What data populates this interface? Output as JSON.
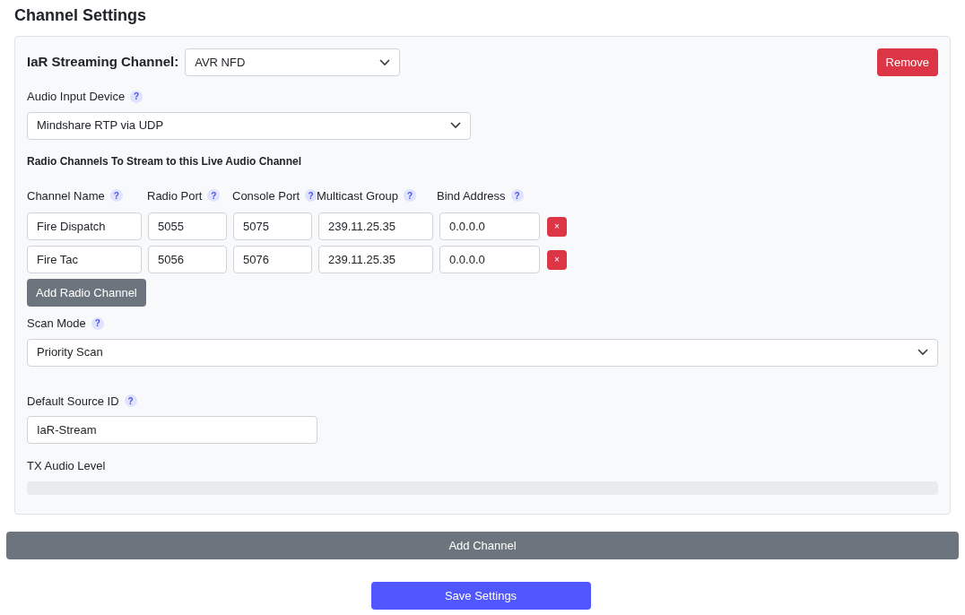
{
  "title": "Channel Settings",
  "channel": {
    "label": "IaR Streaming Channel:",
    "value": "AVR NFD",
    "remove": "Remove",
    "audio_input": {
      "label": "Audio Input Device",
      "help": "?",
      "value": "Mindshare RTP via UDP"
    },
    "radio_section": "Radio Channels To Stream to this Live Audio Channel",
    "columns": [
      {
        "label": "Channel Name",
        "help": "?"
      },
      {
        "label": "Radio Port",
        "help": "?"
      },
      {
        "label": "Console Port",
        "help": "?"
      },
      {
        "label": "Multicast Group",
        "help": "?"
      },
      {
        "label": "Bind Address",
        "help": "?"
      }
    ],
    "rows": [
      {
        "cells": [
          "Fire Dispatch",
          "5055",
          "5075",
          "239.11.25.35",
          "0.0.0.0"
        ],
        "remove": "×"
      },
      {
        "cells": [
          "Fire Tac",
          "5056",
          "5076",
          "239.11.25.35",
          "0.0.0.0"
        ],
        "remove": "×"
      }
    ],
    "add_radio": "Add Radio Channel",
    "scan_mode": {
      "label": "Scan Mode",
      "help": "?",
      "value": "Priority Scan"
    },
    "source_id": {
      "label": "Default Source ID",
      "help": "?",
      "value": "IaR-Stream"
    },
    "tx_level": {
      "label": "TX Audio Level",
      "level": 0
    }
  },
  "add_channel": "Add Channel",
  "save": "Save Settings"
}
